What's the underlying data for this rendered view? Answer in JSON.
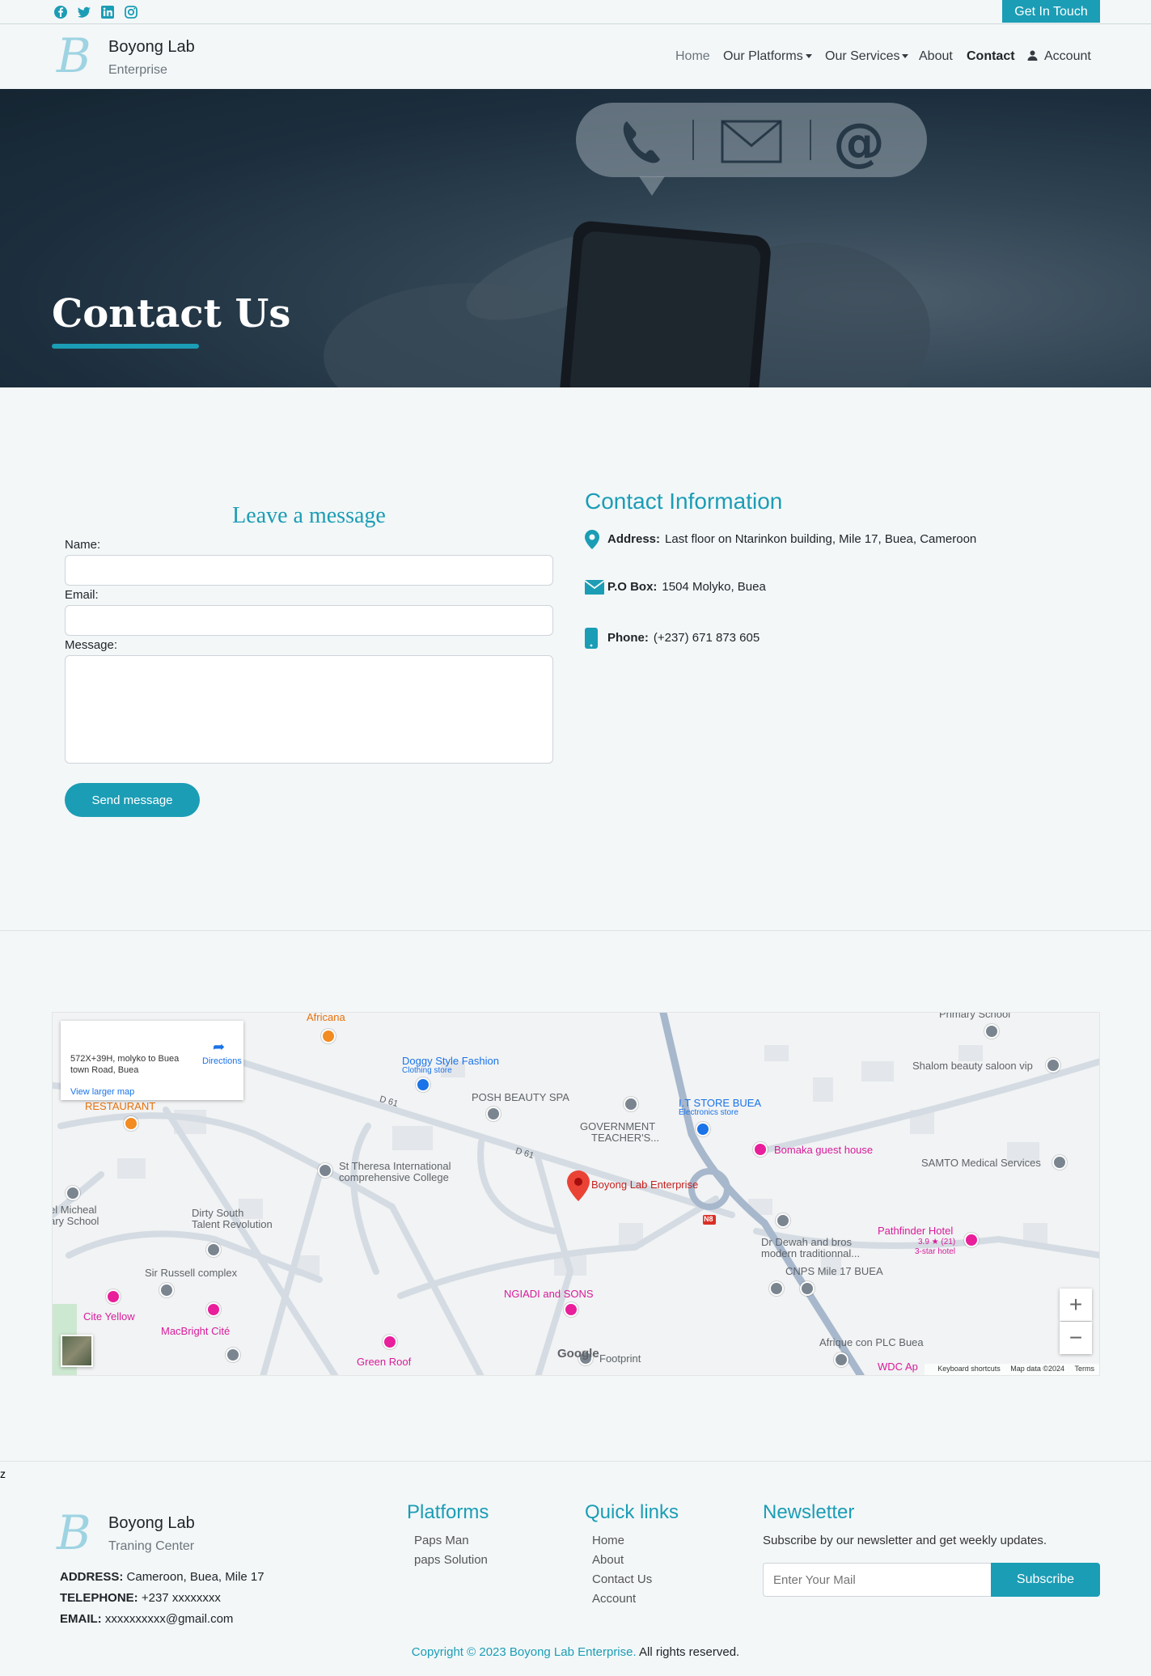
{
  "social": {
    "icons": [
      "facebook-icon",
      "twitter-icon",
      "linkedin-icon",
      "instagram-icon"
    ]
  },
  "topbar": {
    "cta_label": "Get In Touch"
  },
  "brand": {
    "title": "Boyong Lab",
    "subtitle": "Enterprise",
    "logo_letter": "B"
  },
  "nav": {
    "home": "Home",
    "platforms": "Our Platforms",
    "services": "Our Services",
    "about": "About",
    "contact": "Contact",
    "account": "Account"
  },
  "hero": {
    "title": "Contact Us"
  },
  "form": {
    "title": "Leave a message",
    "name_label": "Name:",
    "email_label": "Email:",
    "message_label": "Message:",
    "name_value": "",
    "email_value": "",
    "message_value": "",
    "submit_label": "Send message"
  },
  "contact_info": {
    "title": "Contact Information",
    "address_label": "Address:",
    "address_value": "Last floor on Ntarinkon building, Mile 17, Buea, Cameroon",
    "pobox_label": "P.O Box:",
    "pobox_value": "1504 Molyko, Buea",
    "phone_label": "Phone:",
    "phone_value": "(+237) 671 873 605"
  },
  "map": {
    "card_address": "572X+39H, molyko to Buea town Road, Buea",
    "directions": "Directions",
    "view_larger": "View larger map",
    "marker_label": "Boyong Lab Enterprise",
    "google": "Google",
    "footer": {
      "shortcuts": "Keyboard shortcuts",
      "data": "Map data ©2024",
      "terms": "Terms"
    },
    "zoom_in": "+",
    "zoom_out": "−",
    "places": {
      "africana": "Africana",
      "restaurant": "RESTAURANT",
      "doggy": "Doggy Style Fashion",
      "doggy_sub": "Clothing store",
      "posh": "POSH BEAUTY SPA",
      "gov": "GOVERNMENT",
      "gov2": "TEACHER'S...",
      "itstore": "I.T STORE BUEA",
      "itstore_sub": "Electronics store",
      "primary": "Primary School",
      "shalom": "Shalom beauty saloon vip",
      "bomaka": "Bomaka guest house",
      "samto": "SAMTO Medical Services",
      "theresa": "St Theresa International",
      "theresa2": "comprehensive College",
      "micheal": "el Micheal",
      "micheal2": "ary School",
      "dirty": "Dirty South",
      "dirty2": "Talent Revolution",
      "russell": "Sir Russell complex",
      "pathfinder": "Pathfinder Hotel",
      "pathfinder_rating": "3.9 ★ (21)",
      "pathfinder_sub": "3-star hotel",
      "dewah": "Dr Dewah and bros",
      "dewah2": "modern traditionnal...",
      "cnps": "CNPS Mile 17 BUEA",
      "ngiadi": "NGIADI and SONS",
      "cite": "Cite Yellow",
      "macbright": "MacBright Cité",
      "greenroof": "Green Roof",
      "footprint": "Footprint",
      "afrique": "Afrique con PLC Buea",
      "wdc": "WDC Ap",
      "d61a": "D 61",
      "d61b": "D 61",
      "n8": "N8"
    }
  },
  "stray_char": "z",
  "footer": {
    "brand_title": "Boyong Lab",
    "brand_subtitle": "Traning Center",
    "address_label": "ADDRESS:",
    "address_value": "Cameroon, Buea, Mile 17",
    "telephone_label": "TELEPHONE:",
    "telephone_value": "+237 xxxxxxxx",
    "email_label": "EMAIL:",
    "email_value": "xxxxxxxxxx@gmail.com",
    "platforms_title": "Platforms",
    "platforms": [
      "Paps Man",
      "paps Solution"
    ],
    "quicklinks_title": "Quick links",
    "quicklinks": [
      "Home",
      "About",
      "Contact Us",
      "Account"
    ],
    "newsletter_title": "Newsletter",
    "newsletter_desc": "Subscribe by our newsletter and get weekly updates.",
    "newsletter_placeholder": "Enter Your Mail",
    "subscribe_label": "Subscribe",
    "copyright_a": "Copyright © 2023 Boyong Lab Enterprise.",
    "copyright_b": " All rights reserved."
  },
  "colors": {
    "accent": "#1b9db5",
    "background": "#f3f7f8",
    "hero_dark": "#1c2e3d"
  }
}
